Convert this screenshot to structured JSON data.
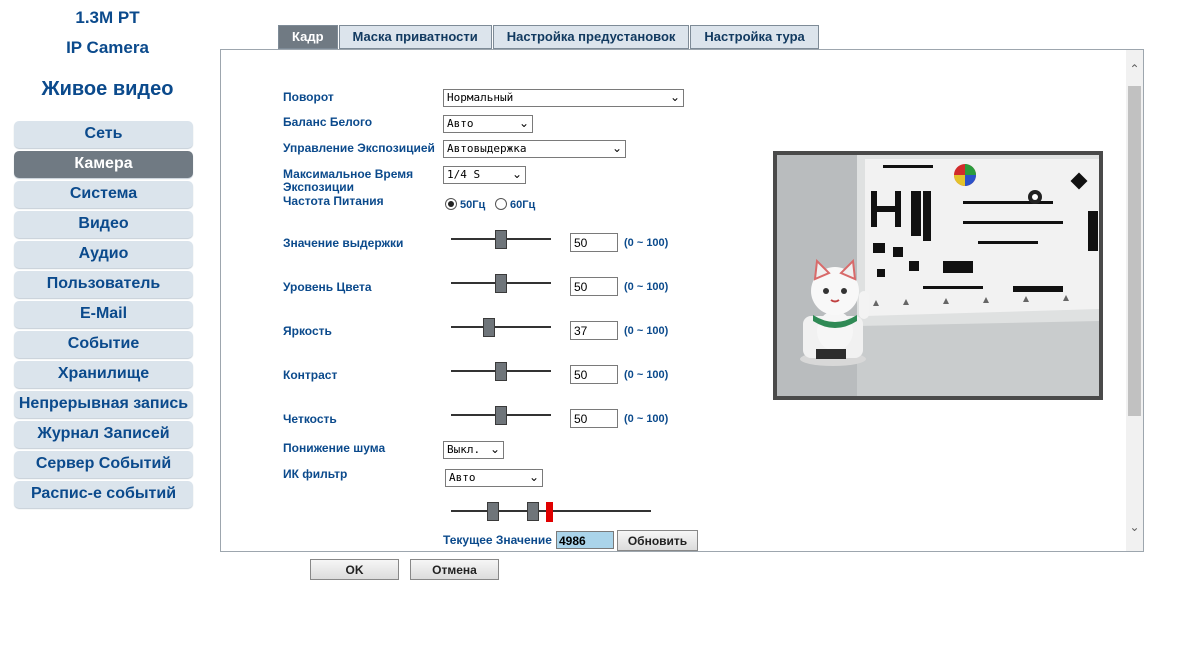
{
  "brand": {
    "model": "1.3M PT",
    "product": "IP Camera"
  },
  "live_video": "Живое видео",
  "nav": [
    {
      "label": "Сеть",
      "active": false
    },
    {
      "label": "Камера",
      "active": true
    },
    {
      "label": "Система",
      "active": false
    },
    {
      "label": "Видео",
      "active": false
    },
    {
      "label": "Аудио",
      "active": false
    },
    {
      "label": "Пользователь",
      "active": false
    },
    {
      "label": "E-Mail",
      "active": false
    },
    {
      "label": "Событие",
      "active": false
    },
    {
      "label": "Хранилище",
      "active": false
    },
    {
      "label": "Непрерывная запись",
      "active": false
    },
    {
      "label": "Журнал Записей",
      "active": false
    },
    {
      "label": "Сервер Событий",
      "active": false
    },
    {
      "label": "Распис-е событий",
      "active": false
    }
  ],
  "tabs": [
    {
      "label": "Кадр",
      "active": true
    },
    {
      "label": "Маска приватности",
      "active": false
    },
    {
      "label": "Настройка предустановок",
      "active": false
    },
    {
      "label": "Настройка тура",
      "active": false
    }
  ],
  "form": {
    "rotation": {
      "label": "Поворот",
      "value": "Нормальный"
    },
    "white_balance": {
      "label": "Баланс Белого",
      "value": "Авто"
    },
    "exposure_control": {
      "label": "Управление Экспозицией",
      "value": "Автовыдержка"
    },
    "max_exposure": {
      "label": "Максимальное Время Экспозиции",
      "value": "1/4 S"
    },
    "power_freq": {
      "label": "Частота Питания",
      "option_50": "50Гц",
      "option_60": "60Гц",
      "selected": "50Гц"
    },
    "sliders": [
      {
        "label": "Значение выдержки",
        "value": "50",
        "range": "(0 ~ 100)",
        "level": 50
      },
      {
        "label": "Уровень Цвета",
        "value": "50",
        "range": "(0 ~ 100)",
        "level": 50
      },
      {
        "label": "Яркость",
        "value": "37",
        "range": "(0 ~ 100)",
        "level": 37
      },
      {
        "label": "Контраст",
        "value": "50",
        "range": "(0 ~ 100)",
        "level": 50
      },
      {
        "label": "Четкость",
        "value": "50",
        "range": "(0 ~ 100)",
        "level": 50
      }
    ],
    "noise_reduction": {
      "label": "Понижение шума",
      "value": "Выкл."
    },
    "ir_filter": {
      "label": "ИК фильтр",
      "value": "Авто"
    },
    "current_value": {
      "label": "Текущее Значение",
      "value": "4986",
      "refresh": "Обновить"
    }
  },
  "buttons": {
    "ok": "OK",
    "cancel": "Отмена"
  },
  "colors": {
    "brand": "#0b4a8c",
    "active_tab": "#707a83",
    "nav_bg": "#dbe4ec",
    "ir_marker": "#e00000"
  }
}
